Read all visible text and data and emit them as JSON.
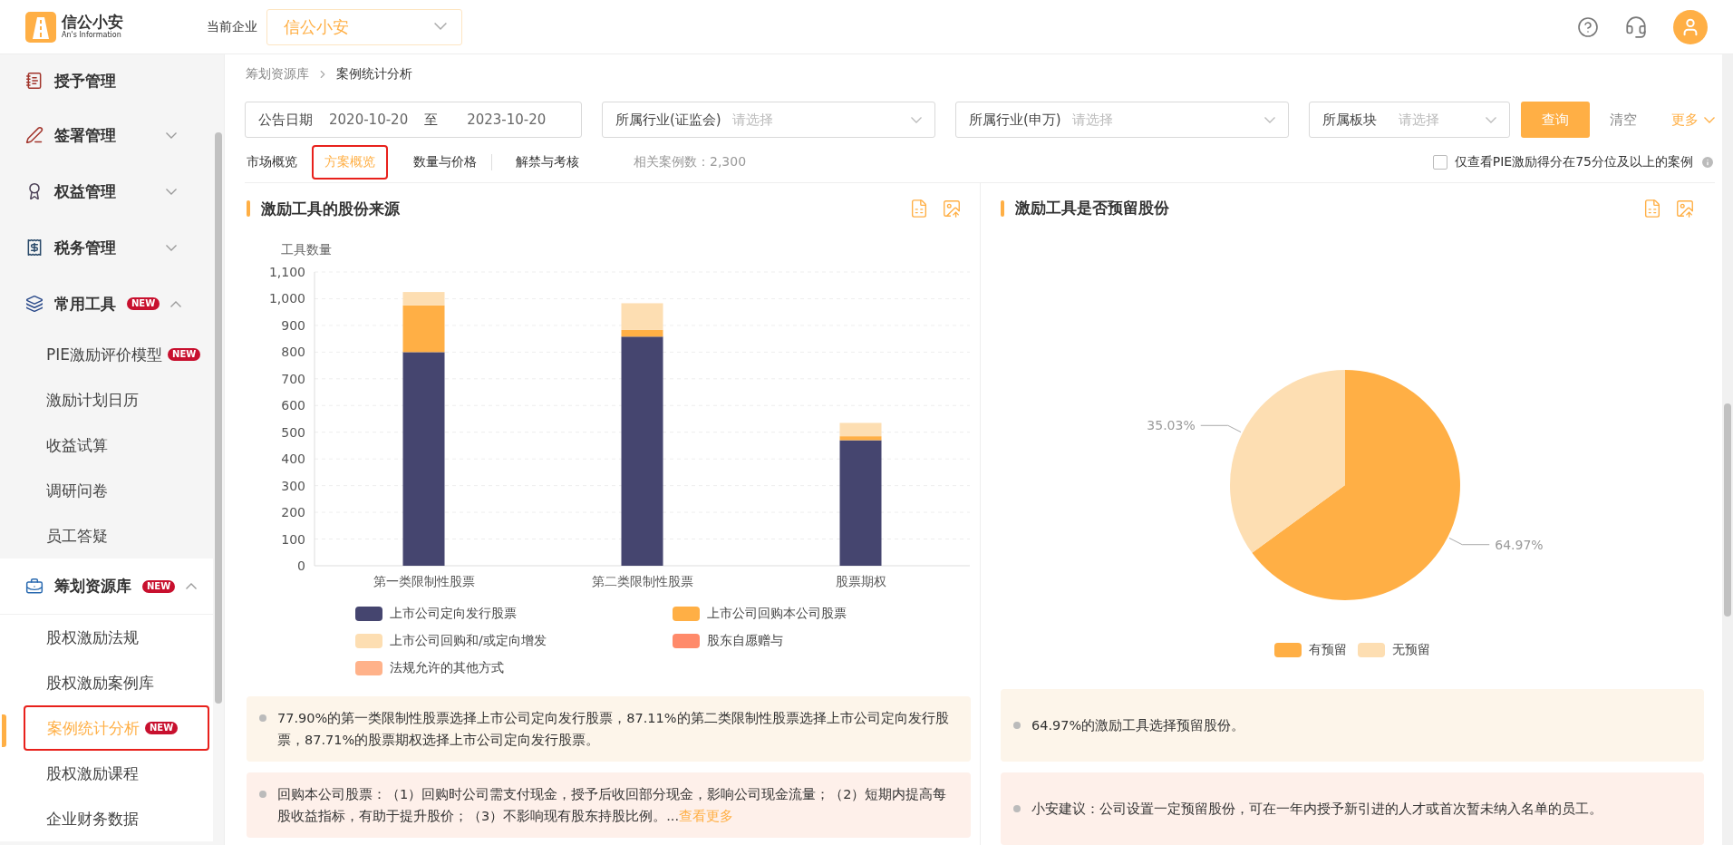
{
  "header": {
    "logo_title": "信公小安",
    "logo_subtitle": "An's Information",
    "company_label": "当前企业",
    "company_value": "信公小安"
  },
  "sidebar": {
    "items": [
      {
        "label": "授予管理",
        "active": false
      },
      {
        "label": "签署管理",
        "expanded": false,
        "active": false
      },
      {
        "label": "权益管理",
        "expanded": false,
        "active": false
      },
      {
        "label": "税务管理",
        "expanded": false,
        "active": false
      },
      {
        "label": "常用工具",
        "badge": "NEW",
        "expanded": true,
        "active": false,
        "children": [
          {
            "label": "PIE激励评价模型",
            "badge": "NEW",
            "selected": false,
            "highlighted": false
          },
          {
            "label": "激励计划日历",
            "selected": false,
            "highlighted": false
          },
          {
            "label": "收益试算",
            "selected": false,
            "highlighted": false
          },
          {
            "label": "调研问卷",
            "selected": false,
            "highlighted": false
          },
          {
            "label": "员工答疑",
            "selected": false,
            "highlighted": false
          }
        ]
      },
      {
        "label": "筹划资源库",
        "badge": "NEW",
        "expanded": true,
        "active": true,
        "children": [
          {
            "label": "股权激励法规",
            "selected": false,
            "highlighted": false
          },
          {
            "label": "股权激励案例库",
            "selected": false,
            "highlighted": false
          },
          {
            "label": "案例统计分析",
            "badge": "NEW",
            "selected": true,
            "highlighted": true
          },
          {
            "label": "股权激励课程",
            "selected": false,
            "highlighted": false
          },
          {
            "label": "企业财务数据",
            "selected": false,
            "highlighted": false
          }
        ]
      }
    ]
  },
  "breadcrumb": [
    "筹划资源库",
    "案例统计分析"
  ],
  "filters": {
    "date": {
      "label": "公告日期",
      "from": "2020-10-20",
      "separator": "至",
      "to": "2023-10-20"
    },
    "selects": [
      {
        "label": "所属行业(证监会)",
        "placeholder": "请选择"
      },
      {
        "label": "所属行业(申万)",
        "placeholder": "请选择"
      },
      {
        "label": "所属板块",
        "placeholder": "请选择"
      }
    ],
    "query_button": "查询",
    "clear_button": "清空",
    "more_button": "更多"
  },
  "tabs": [
    {
      "label": "市场概览",
      "selected": false,
      "highlighted": false
    },
    {
      "label": "方案概览",
      "selected": true,
      "highlighted": true
    },
    {
      "label": "数量与价格",
      "selected": false,
      "highlighted": false
    },
    {
      "label": "解禁与考核",
      "selected": false,
      "highlighted": false
    }
  ],
  "case_count": "相关案例数：2,300",
  "filter_checkbox": {
    "label": "仅查看PIE激励得分在75分位及以上的案例",
    "checked": false
  },
  "panels": [
    {
      "title": "激励工具的股份来源",
      "chart_data": {
        "type": "bar",
        "stacked": true,
        "grid": true,
        "ylabel": "工具数量",
        "categories": [
          "第一类限制性股票",
          "第二类限制性股票",
          "股票期权"
        ],
        "ylim": [
          0,
          1100
        ],
        "yticks": [
          0,
          100,
          200,
          300,
          400,
          500,
          600,
          700,
          800,
          900,
          {
            "value": 1000,
            "label": "1,000"
          },
          {
            "value": 1100,
            "label": "1,100"
          }
        ],
        "series": [
          {
            "name": "上市公司定向发行股票",
            "color": "#45456f",
            "values": [
              800,
              858,
              470
            ]
          },
          {
            "name": "上市公司回购本公司股票",
            "color": "#ffaf45",
            "values": [
              175,
              25,
              15
            ]
          },
          {
            "name": "上市公司回购和/或定向增发",
            "color": "#fddeb2",
            "values": [
              50,
              100,
              50
            ]
          },
          {
            "name": "股东自愿赠与",
            "color": "#ff8a6a",
            "values": [
              0,
              0,
              0
            ]
          },
          {
            "name": "法规允许的其他方式",
            "color": "#ffb28a",
            "values": [
              0,
              0,
              0
            ]
          }
        ]
      },
      "notes": [
        {
          "color": "#fdf5ea",
          "text": "77.90%的第一类限制性股票选择上市公司定向发行股票，87.11%的第二类限制性股票选择上市公司定向发行股票，87.71%的股票期权选择上市公司定向发行股票。"
        },
        {
          "color": "#fef0ea",
          "text": "回购本公司股票：（1）回购时公司需支付现金，授予后收回部分现金，影响公司现金流量；（2）短期内提高每股收益指标，有助于提升股价；（3）不影响现有股东持股比例。...",
          "link": "查看更多"
        }
      ]
    },
    {
      "title": "激励工具是否预留股份",
      "chart_data": {
        "type": "pie",
        "categories": [
          "有预留",
          "无预留"
        ],
        "values": [
          64.97,
          35.03
        ],
        "colors": [
          "#ffaf45",
          "#fddeb2"
        ],
        "value_labels": [
          "64.97%",
          "35.03%"
        ]
      },
      "notes": [
        {
          "color": "#fdf5ea",
          "text": "64.97%的激励工具选择预留股份。"
        },
        {
          "color": "#fef0ea",
          "text": "小安建议：公司设置一定预留股份，可在一年内授予新引进的人才或首次暂未纳入名单的员工。"
        }
      ]
    }
  ]
}
